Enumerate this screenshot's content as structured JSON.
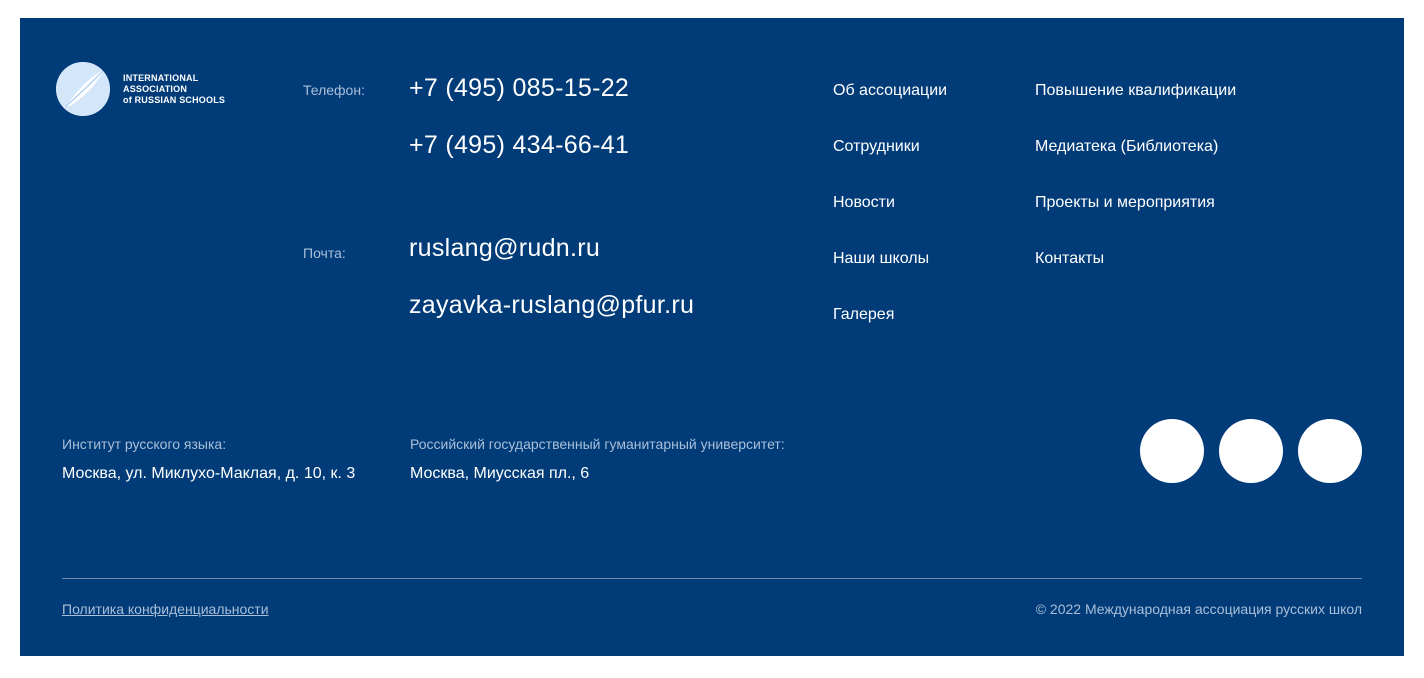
{
  "logo": {
    "line1": "INTERNATIONAL",
    "line2": "ASSOCIATION",
    "line3": "of RUSSIAN SCHOOLS"
  },
  "contacts": {
    "phone_label": "Телефон:",
    "phones": [
      "+7 (495) 085-15-22",
      "+7 (495) 434-66-41"
    ],
    "email_label": "Почта:",
    "emails": [
      "ruslang@rudn.ru",
      "zayavka-ruslang@pfur.ru"
    ]
  },
  "nav": {
    "col1": [
      "Об ассоциации",
      "Сотрудники",
      "Новости",
      "Наши школы",
      "Галерея"
    ],
    "col2": [
      "Повышение квалификации",
      "Медиатека (Библиотека)",
      "Проекты и мероприятия",
      "Контакты"
    ]
  },
  "addresses": [
    {
      "label": "Институт русского языка:",
      "value": "Москва, ул. Миклухо-Маклая, д. 10, к. 3"
    },
    {
      "label": "Российский государственный гуманитарный университет:",
      "value": "Москва, Миусская пл., 6"
    }
  ],
  "social": {
    "icons": [
      "social-icon-1",
      "social-icon-2",
      "social-icon-3"
    ]
  },
  "bottom": {
    "privacy": "Политика конфиденциальности",
    "copyright": "© 2022 Международная ассоциация русских школ"
  },
  "colors": {
    "background": "#013c79",
    "text": "#ffffff",
    "muted": "#a9bfd9"
  }
}
